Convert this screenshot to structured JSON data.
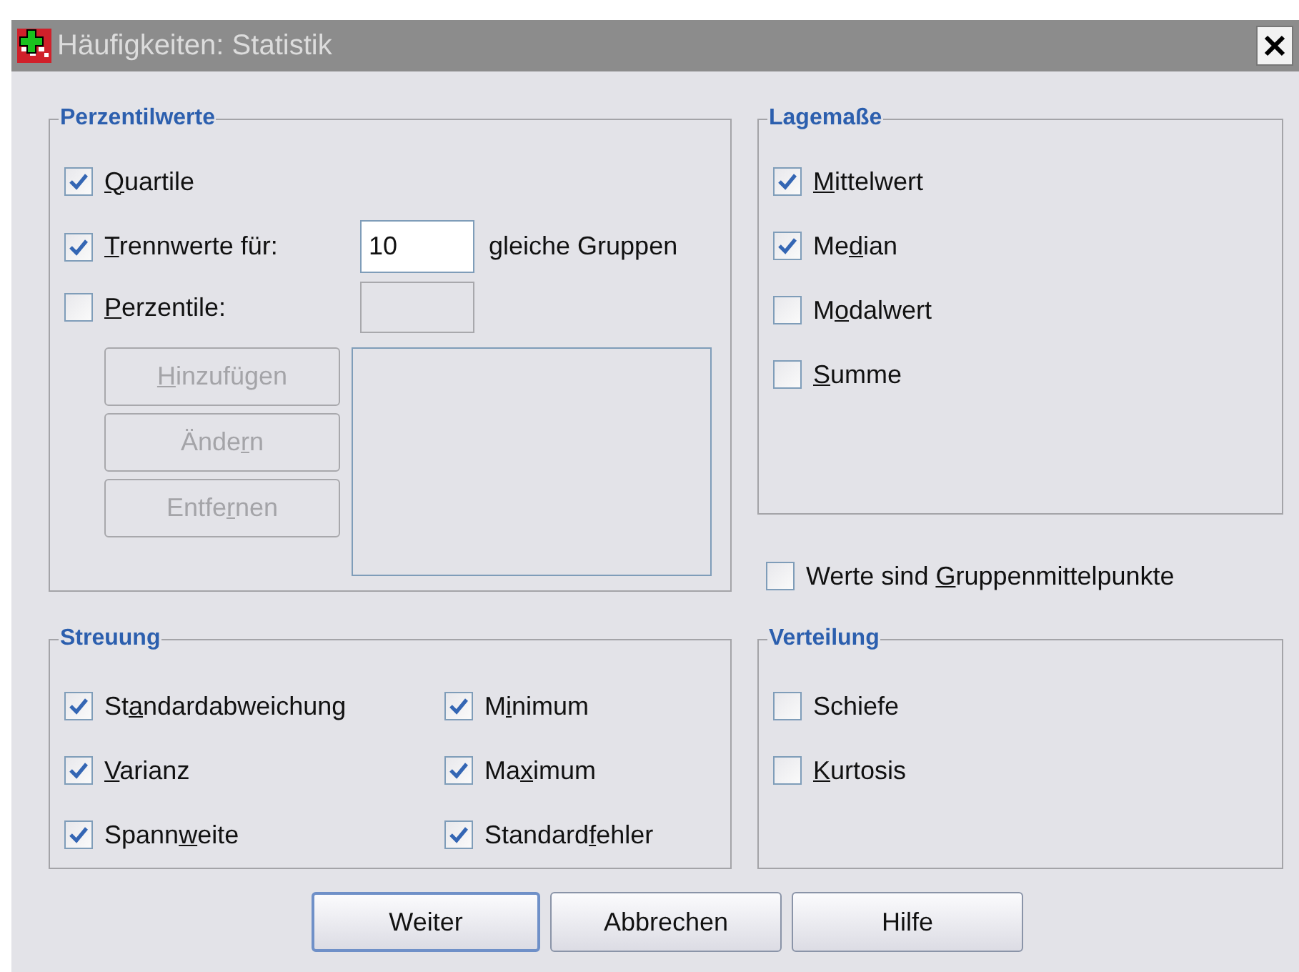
{
  "window": {
    "title": "Häufigkeiten: Statistik"
  },
  "perzentilwerte": {
    "title": "Perzentilwerte",
    "quartile": {
      "label": {
        "key": "Q",
        "after": "uartile"
      },
      "checked": true
    },
    "trennwerte": {
      "label": {
        "key": "T",
        "after": "rennwerte für:"
      },
      "checked": true,
      "value": "10",
      "suffix": "gleiche Gruppen"
    },
    "perzentile": {
      "label": {
        "key": "P",
        "after": "erzentile:"
      },
      "checked": false,
      "field_disabled": true
    },
    "buttons": [
      {
        "label": {
          "key": "H",
          "after": "inzufügen"
        },
        "disabled": true
      },
      {
        "label": {
          "before": "Ände",
          "key": "r",
          "after": "n"
        },
        "disabled": true
      },
      {
        "label": {
          "before": "Entfe",
          "key": "r",
          "after": "nen"
        },
        "disabled": true
      }
    ]
  },
  "lagemasse": {
    "title": "Lagemaße",
    "items": [
      {
        "label": {
          "key": "M",
          "after": "ittelwert"
        },
        "checked": true
      },
      {
        "label": {
          "before": "Me",
          "key": "d",
          "after": "ian"
        },
        "checked": true
      },
      {
        "label": {
          "before": "M",
          "key": "o",
          "after": "dalwert"
        },
        "checked": false
      },
      {
        "label": {
          "key": "S",
          "after": "umme"
        },
        "checked": false
      }
    ]
  },
  "gruppenmittelpunkte": {
    "label": {
      "before": "Werte sind ",
      "key": "G",
      "after": "ruppenmittelpunkte"
    },
    "checked": false
  },
  "streuung": {
    "title": "Streuung",
    "items": [
      {
        "label": {
          "before": "St",
          "key": "a",
          "after": "ndardabweichung"
        },
        "checked": true
      },
      {
        "label": {
          "before": "M",
          "key": "i",
          "after": "nimum"
        },
        "checked": true
      },
      {
        "label": {
          "key": "V",
          "after": "arianz"
        },
        "checked": true
      },
      {
        "label": {
          "before": "Ma",
          "key": "x",
          "after": "imum"
        },
        "checked": true
      },
      {
        "label": {
          "before": "Spann",
          "key": "w",
          "after": "eite"
        },
        "checked": true
      },
      {
        "label": {
          "before": "Standard",
          "key": "f",
          "after": "ehler"
        },
        "checked": true
      }
    ]
  },
  "verteilung": {
    "title": "Verteilung",
    "items": [
      {
        "label": {
          "before": "Schiefe"
        },
        "checked": false
      },
      {
        "label": {
          "key": "K",
          "after": "urtosis"
        },
        "checked": false
      }
    ]
  },
  "buttons": [
    {
      "label": "Weiter",
      "default": true
    },
    {
      "label": "Abbrechen",
      "default": false
    },
    {
      "label": "Hilfe",
      "default": false
    }
  ]
}
